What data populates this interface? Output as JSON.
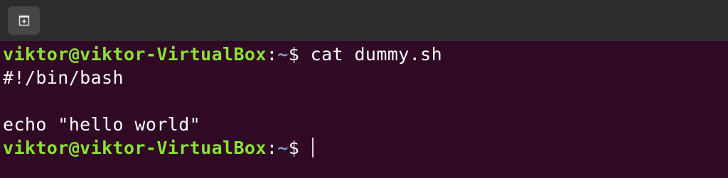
{
  "window": {
    "new_tab_icon": "new-tab-icon"
  },
  "colors": {
    "background": "#300a24",
    "titlebar": "#2c2c2c",
    "prompt_user": "#8ae234",
    "prompt_path": "#729fcf",
    "text": "#ffffff"
  },
  "terminal": {
    "prompt1": {
      "user_host": "viktor@viktor-VirtualBox",
      "colon": ":",
      "path": "~",
      "symbol": "$",
      "command": " cat dummy.sh"
    },
    "output": {
      "line1": "#!/bin/bash",
      "line2": "",
      "line3": "echo \"hello world\""
    },
    "prompt2": {
      "user_host": "viktor@viktor-VirtualBox",
      "colon": ":",
      "path": "~",
      "symbol": "$",
      "command": " "
    }
  }
}
